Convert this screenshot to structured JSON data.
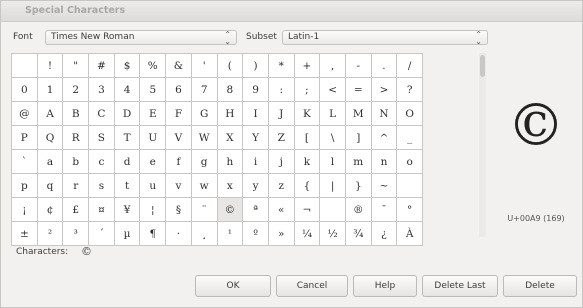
{
  "window": {
    "title": "Special Characters"
  },
  "font": {
    "label": "Font",
    "value": "Times New Roman",
    "arrow": "⌃⌄"
  },
  "subset": {
    "label": "Subset",
    "value": "Latin-1",
    "arrow": "⌃⌄"
  },
  "grid": {
    "rows": [
      [
        " ",
        "!",
        "\"",
        "#",
        "$",
        "%",
        "&",
        "'",
        "(",
        ")",
        "*",
        "+",
        ",",
        "-",
        ".",
        "/"
      ],
      [
        "0",
        "1",
        "2",
        "3",
        "4",
        "5",
        "6",
        "7",
        "8",
        "9",
        ":",
        ";",
        "<",
        "=",
        ">",
        "?"
      ],
      [
        "@",
        "A",
        "B",
        "C",
        "D",
        "E",
        "F",
        "G",
        "H",
        "I",
        "J",
        "K",
        "L",
        "M",
        "N",
        "O"
      ],
      [
        "P",
        "Q",
        "R",
        "S",
        "T",
        "U",
        "V",
        "W",
        "X",
        "Y",
        "Z",
        "[",
        "\\",
        "]",
        "^",
        "_"
      ],
      [
        "`",
        "a",
        "b",
        "c",
        "d",
        "e",
        "f",
        "g",
        "h",
        "i",
        "j",
        "k",
        "l",
        "m",
        "n",
        "o"
      ],
      [
        "p",
        "q",
        "r",
        "s",
        "t",
        "u",
        "v",
        "w",
        "x",
        "y",
        "z",
        "{",
        "|",
        "}",
        "~",
        ""
      ],
      [
        "¡",
        "¢",
        "£",
        "¤",
        "¥",
        "¦",
        "§",
        "¨",
        "©",
        "ª",
        "«",
        "¬",
        "",
        "®",
        "¯",
        "°"
      ],
      [
        "±",
        "²",
        "³",
        "´",
        "µ",
        "¶",
        "·",
        "¸",
        "¹",
        "º",
        "»",
        "¼",
        "½",
        "¾",
        "¿",
        "À"
      ]
    ],
    "selected": "©"
  },
  "preview": {
    "glyph": "©",
    "code": "U+00A9 (169)"
  },
  "characters": {
    "label": "Characters:",
    "value": "©"
  },
  "buttons": {
    "ok": "OK",
    "cancel": "Cancel",
    "help": "Help",
    "delete_last": "Delete Last",
    "delete": "Delete"
  }
}
